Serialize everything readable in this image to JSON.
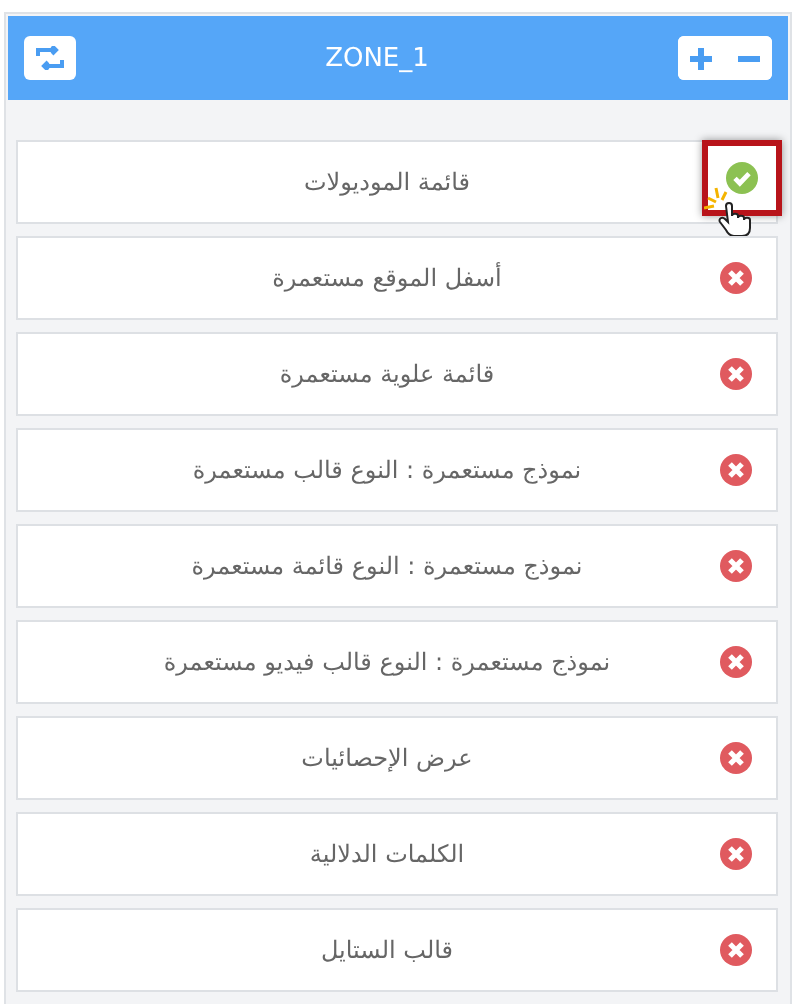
{
  "zone": {
    "title": "ZONE_1"
  },
  "modules": [
    {
      "label": "قائمة الموديولات",
      "enabled": true,
      "highlighted": true
    },
    {
      "label": "أسفل الموقع مستعمرة",
      "enabled": false,
      "highlighted": false
    },
    {
      "label": "قائمة علوية مستعمرة",
      "enabled": false,
      "highlighted": false
    },
    {
      "label": "نموذج مستعمرة : النوع قالب مستعمرة",
      "enabled": false,
      "highlighted": false
    },
    {
      "label": "نموذج مستعمرة : النوع قائمة مستعمرة",
      "enabled": false,
      "highlighted": false
    },
    {
      "label": "نموذج مستعمرة : النوع قالب فيديو مستعمرة",
      "enabled": false,
      "highlighted": false
    },
    {
      "label": "عرض الإحصائيات",
      "enabled": false,
      "highlighted": false
    },
    {
      "label": "الكلمات الدلالية",
      "enabled": false,
      "highlighted": false
    },
    {
      "label": "قالب الستايل",
      "enabled": false,
      "highlighted": false
    }
  ]
}
